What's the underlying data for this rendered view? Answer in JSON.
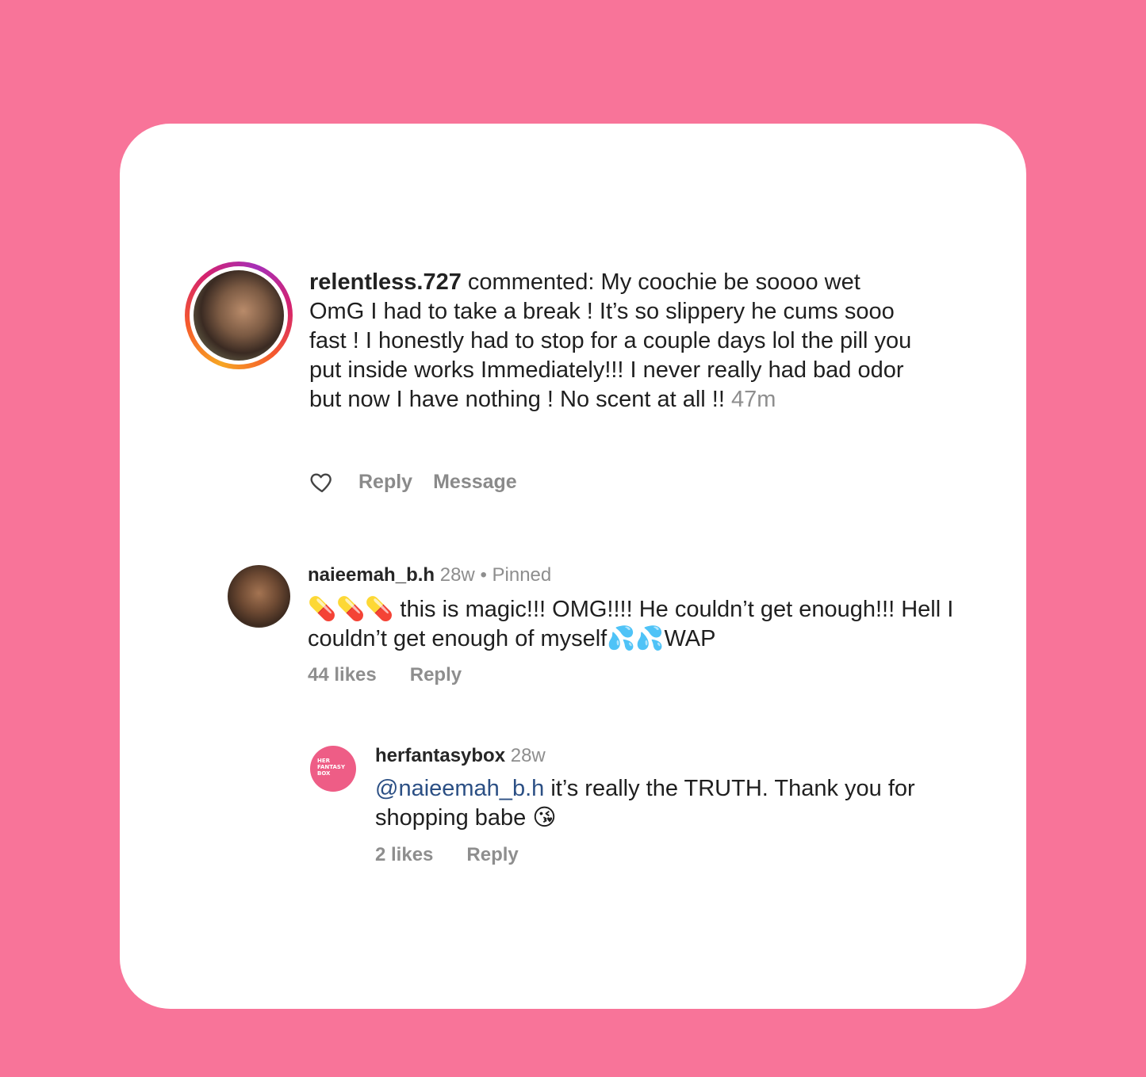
{
  "colors": {
    "background": "#f87499",
    "card": "#ffffff",
    "mention": "#2b4f84",
    "muted": "#8e8e8e"
  },
  "notification": {
    "username": "relentless.727",
    "text": "commented: My coochie be soooo wet OmG I had to take a break ! It’s so slippery he cums sooo fast ! I honestly had to stop for a couple days lol the pill you put inside works Immediately!!! I never really had bad odor but now I have nothing ! No scent at all !!",
    "time": "47m",
    "reply_label": "Reply",
    "message_label": "Message",
    "like_icon": "heart-outline-icon"
  },
  "comment": {
    "username": "naieemah_b.h",
    "time": "28w",
    "separator": "•",
    "pinned_label": "Pinned",
    "emoji_prefix": "💊💊💊",
    "text_part1": " this is magic!!! OMG!!!! He couldn’t get enough!!! Hell I couldn’t get enough of myself",
    "emoji_mid": "💦💦",
    "text_part2": "WAP",
    "likes": "44 likes",
    "reply_label": "Reply"
  },
  "reply": {
    "avatar_text": "HER FANTASY BOX",
    "username": "herfantasybox",
    "time": "28w",
    "mention": "@naieemah_b.h",
    "text": " it’s really the TRUTH. Thank you for shopping babe ",
    "emoji": "😘",
    "likes": "2 likes",
    "reply_label": "Reply"
  }
}
